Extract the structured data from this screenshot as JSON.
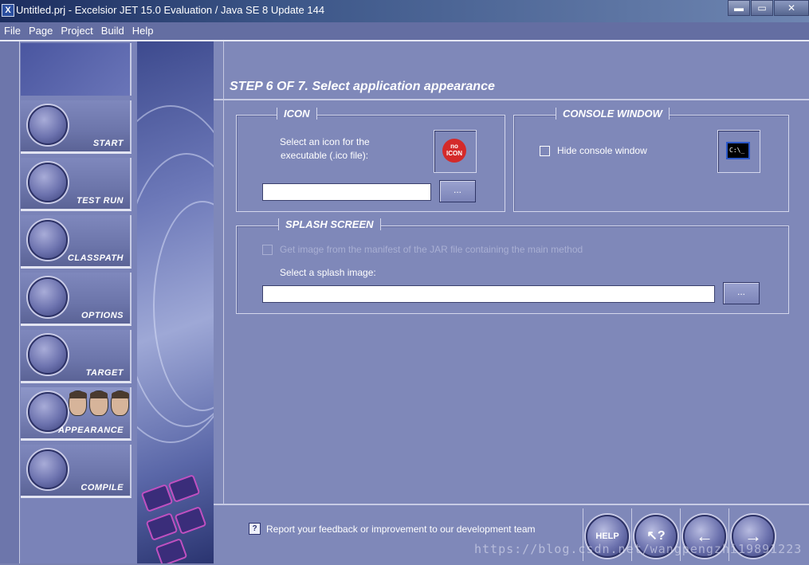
{
  "window": {
    "app_icon": "X",
    "title": "Untitled.prj - Excelsior JET 15.0 Evaluation / Java SE 8 Update 144",
    "minimize_glyph": "▬",
    "maximize_glyph": "▭",
    "close_glyph": "✕"
  },
  "menu": [
    "File",
    "Page",
    "Project",
    "Build",
    "Help"
  ],
  "nav": {
    "items": [
      {
        "label": "START"
      },
      {
        "label": "TEST RUN"
      },
      {
        "label": "CLASSPATH"
      },
      {
        "label": "OPTIONS"
      },
      {
        "label": "TARGET"
      },
      {
        "label": "APPEARANCE"
      },
      {
        "label": "COMPILE"
      }
    ],
    "active": "APPEARANCE"
  },
  "step_title": "STEP 6 OF 7. Select application appearance",
  "icon_group": {
    "legend": "ICON",
    "description_line1": "Select an icon for the",
    "description_line2": "executable (.ico file):",
    "preview_text_line1": "no",
    "preview_text_line2": "ICON",
    "path_value": "",
    "browse_label": "..."
  },
  "console_group": {
    "legend": "CONSOLE WINDOW",
    "hide_label": "Hide console window",
    "hide_checked": false,
    "preview_text": "C:\\_"
  },
  "splash_group": {
    "legend": "SPLASH SCREEN",
    "manifest_label": "Get image from the manifest of the JAR file containing the main method",
    "manifest_checked": false,
    "manifest_enabled": false,
    "select_label": "Select a splash image:",
    "path_value": "",
    "browse_label": "..."
  },
  "footer": {
    "feedback_icon": "?",
    "feedback_text": "Report your feedback or improvement to our development team",
    "help_label": "HELP",
    "context_help_label": "↖?",
    "back_label": "←",
    "next_label": "→"
  },
  "watermark": "https://blog.csdn.net/wangpengzhi19891223"
}
